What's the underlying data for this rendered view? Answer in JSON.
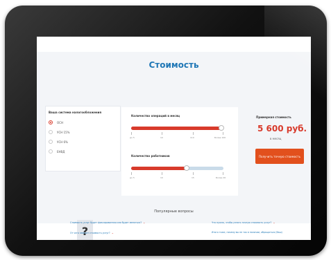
{
  "calculator": {
    "title": "Стоимость",
    "tax_systems": {
      "title": "Ваша система налогообложения",
      "options": [
        {
          "label": "ОСН",
          "selected": true
        },
        {
          "label": "УСН 15%",
          "selected": false
        },
        {
          "label": "УСН 6%",
          "selected": false
        },
        {
          "label": "ЕНВД",
          "selected": false
        }
      ]
    },
    "operations": {
      "title": "Количество операций в месяц",
      "value_fraction": 0.98,
      "ticks": [
        "до 5",
        "10",
        "110",
        "Более 100"
      ]
    },
    "employees": {
      "title": "Количество работников",
      "value_fraction": 0.6,
      "ticks": [
        "до 5",
        "10",
        "15",
        "Более 20"
      ]
    },
    "result": {
      "label": "Примерная стоимость",
      "price": "5 600 руб.",
      "period": "в месяц",
      "cta": "Получить точную стоимость"
    }
  },
  "faq": {
    "title": "Популярные вопросы",
    "items": [
      "Стоимость услуг будет фиксированная или будет меняться?",
      "От чего зависит стоимость услуг?",
      "Что нужно, чтобы узнать точную стоимость услуг?",
      "Итого тоже, почему вы не так в наличии, обращаться (Ваш)"
    ]
  },
  "colors": {
    "accent": "#1f77b6",
    "brand_red": "#d83a2b",
    "button": "#e2501d"
  }
}
